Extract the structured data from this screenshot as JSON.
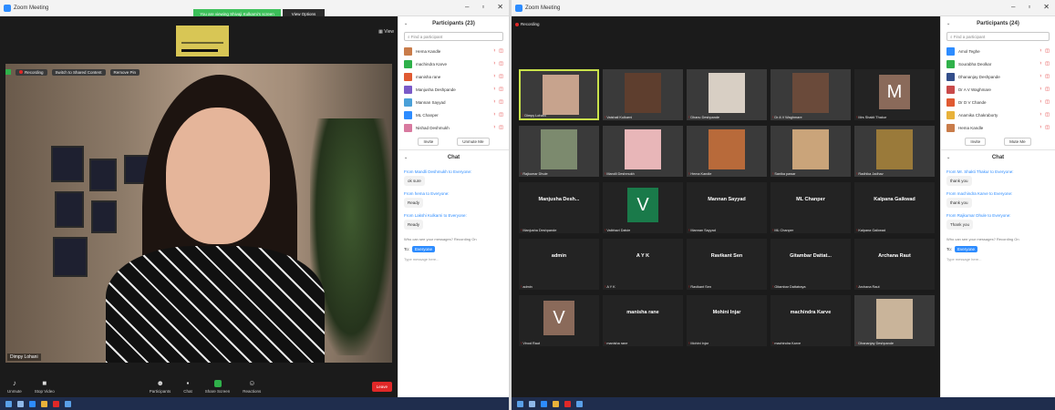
{
  "left": {
    "window_title": "Zoom Meeting",
    "share_banner": "You are viewing Shivaji Kulkarni's screen",
    "view_options": "View Options",
    "view_label": "View",
    "recording_label": "Recording",
    "strip_btn1": "Switch to Shared Content",
    "strip_btn2": "Remove Pin",
    "speaker_name": "Dimpy Lohani",
    "participants_title": "Participants (23)",
    "find_placeholder": "Find a participant",
    "participants": [
      {
        "name": "Hema Kandle",
        "color": "#c97c4a"
      },
      {
        "name": "machindra Karve",
        "color": "#2fb14a"
      },
      {
        "name": "manisha rane",
        "color": "#e05a32"
      },
      {
        "name": "Manjusha Deshpande",
        "color": "#7a5ac8"
      },
      {
        "name": "Mannan Sayyad",
        "color": "#4aa0d8"
      },
      {
        "name": "ML Chanper",
        "color": "#2d8cff"
      },
      {
        "name": "Nishad Deshmukh",
        "color": "#d87aa0"
      }
    ],
    "invite_btn": "Invite",
    "unmute_btn": "Unmute Me",
    "chat_title": "Chat",
    "chat": [
      {
        "from": "From Mandli Deshmukh to Everyone:",
        "msg": "ok sure"
      },
      {
        "from": "From hema to Everyone:",
        "msg": "Ready"
      },
      {
        "from": "From Lakshi Kulkarni to Everyone:",
        "msg": "Ready"
      }
    ],
    "chat_info": "Who can see your messages? Recording On",
    "to_label": "To:",
    "to_value": "Everyone",
    "chat_input": "Type message here...",
    "toolbar": [
      {
        "label": "Unmute",
        "icon": "mic-icon"
      },
      {
        "label": "Stop Video",
        "icon": "video-icon"
      },
      {
        "label": "Participants",
        "icon": "participants-icon"
      },
      {
        "label": "Chat",
        "icon": "chat-icon"
      },
      {
        "label": "Share Screen",
        "icon": "share-icon"
      },
      {
        "label": "Reactions",
        "icon": "reactions-icon"
      }
    ],
    "end_label": "Leave"
  },
  "right": {
    "window_title": "Zoom Meeting",
    "recording_label": "Recording",
    "participants_title": "Participants (24)",
    "find_placeholder": "Find a participant",
    "participants": [
      {
        "name": "Amol Teghe",
        "color": "#2d8cff"
      },
      {
        "name": "Sourabha Deolkar",
        "color": "#2fb14a"
      },
      {
        "name": "Dhananjay Deshpande",
        "color": "#334e8a"
      },
      {
        "name": "Dr A V Waghmare",
        "color": "#c94a4a"
      },
      {
        "name": "Dr D V Chande",
        "color": "#e05a32"
      },
      {
        "name": "Anamika Chakraborty",
        "color": "#e8b23a"
      },
      {
        "name": "Hema Kandle",
        "color": "#c97c4a"
      }
    ],
    "invite_btn": "Invite",
    "unmute_btn": "Mute Me",
    "chat_title": "Chat",
    "chat": [
      {
        "from": "From Mr. Shakti Thakur to Everyone:",
        "msg": "thank you"
      },
      {
        "from": "From machindra Karve to Everyone:",
        "msg": "thank you"
      },
      {
        "from": "From Rajkumar Dhule to Everyone:",
        "msg": "Thank you"
      }
    ],
    "chat_info": "Who can see your messages? Recording On",
    "to_label": "To:",
    "to_value": "Everyone",
    "chat_input": "Type message here...",
    "tiles": [
      {
        "name": "Dimpy Lohani",
        "type": "photo",
        "color": "#c7a38d",
        "active": true
      },
      {
        "name": "Vaishali Kulkarni",
        "type": "photo",
        "color": "#5e3e2e"
      },
      {
        "name": "Dhanu Deshpande",
        "type": "photo",
        "color": "#d8cfc4"
      },
      {
        "name": "Dr A V Waghmare",
        "type": "photo",
        "color": "#6a4a3a"
      },
      {
        "name": "Mrs Shakti Thakur",
        "type": "letter",
        "letter": "M",
        "color": "#8a6a5a"
      },
      {
        "name": "Rajkumar Dhule",
        "type": "photo",
        "color": "#7c8a6e"
      },
      {
        "name": "Mandli Deshmukh",
        "type": "photo",
        "color": "#e8b6b8"
      },
      {
        "name": "Hema Kandle",
        "type": "photo",
        "color": "#b86a3a"
      },
      {
        "name": "Sanika pawar",
        "type": "photo",
        "color": "#caa47a"
      },
      {
        "name": "Radhika Jadhav",
        "type": "photo",
        "color": "#9a7a3a"
      },
      {
        "name": "Manjusha Desh...",
        "type": "name",
        "label": "Manjusha Deshpande"
      },
      {
        "name": "Vaibhavi Dalvie",
        "type": "letter",
        "letter": "V",
        "color": "#1a7a4a"
      },
      {
        "name": "Mannan Sayyad",
        "type": "name",
        "label": "Mannan Sayyad"
      },
      {
        "name": "ML Chanper",
        "type": "name",
        "label": "ML Chanper"
      },
      {
        "name": "Kalpana Gaikwad",
        "type": "name",
        "label": "Kalpana Gaikwad"
      },
      {
        "name": "admin",
        "type": "name",
        "label": "admin"
      },
      {
        "name": "A Y K",
        "type": "name",
        "label": "A Y K"
      },
      {
        "name": "Ravikant Sen",
        "type": "name",
        "label": "Ravikant Sen"
      },
      {
        "name": "Gitambar Dattat...",
        "type": "name",
        "label": "Gitambar Dattatraya"
      },
      {
        "name": "Archana Raut",
        "type": "name",
        "label": "Archana Raut"
      },
      {
        "name": "Vinod Raut",
        "type": "letter",
        "letter": "V",
        "color": "#8a6a5a"
      },
      {
        "name": "manisha rane",
        "type": "name",
        "label": "manisha rane"
      },
      {
        "name": "Mohini Injar",
        "type": "name",
        "label": "Mohini Injar"
      },
      {
        "name": "machindra Karve",
        "type": "name",
        "label": "machindra Karve"
      },
      {
        "name": "Dhananjay Deshpande",
        "type": "photo",
        "color": "#c9b49a"
      }
    ]
  }
}
